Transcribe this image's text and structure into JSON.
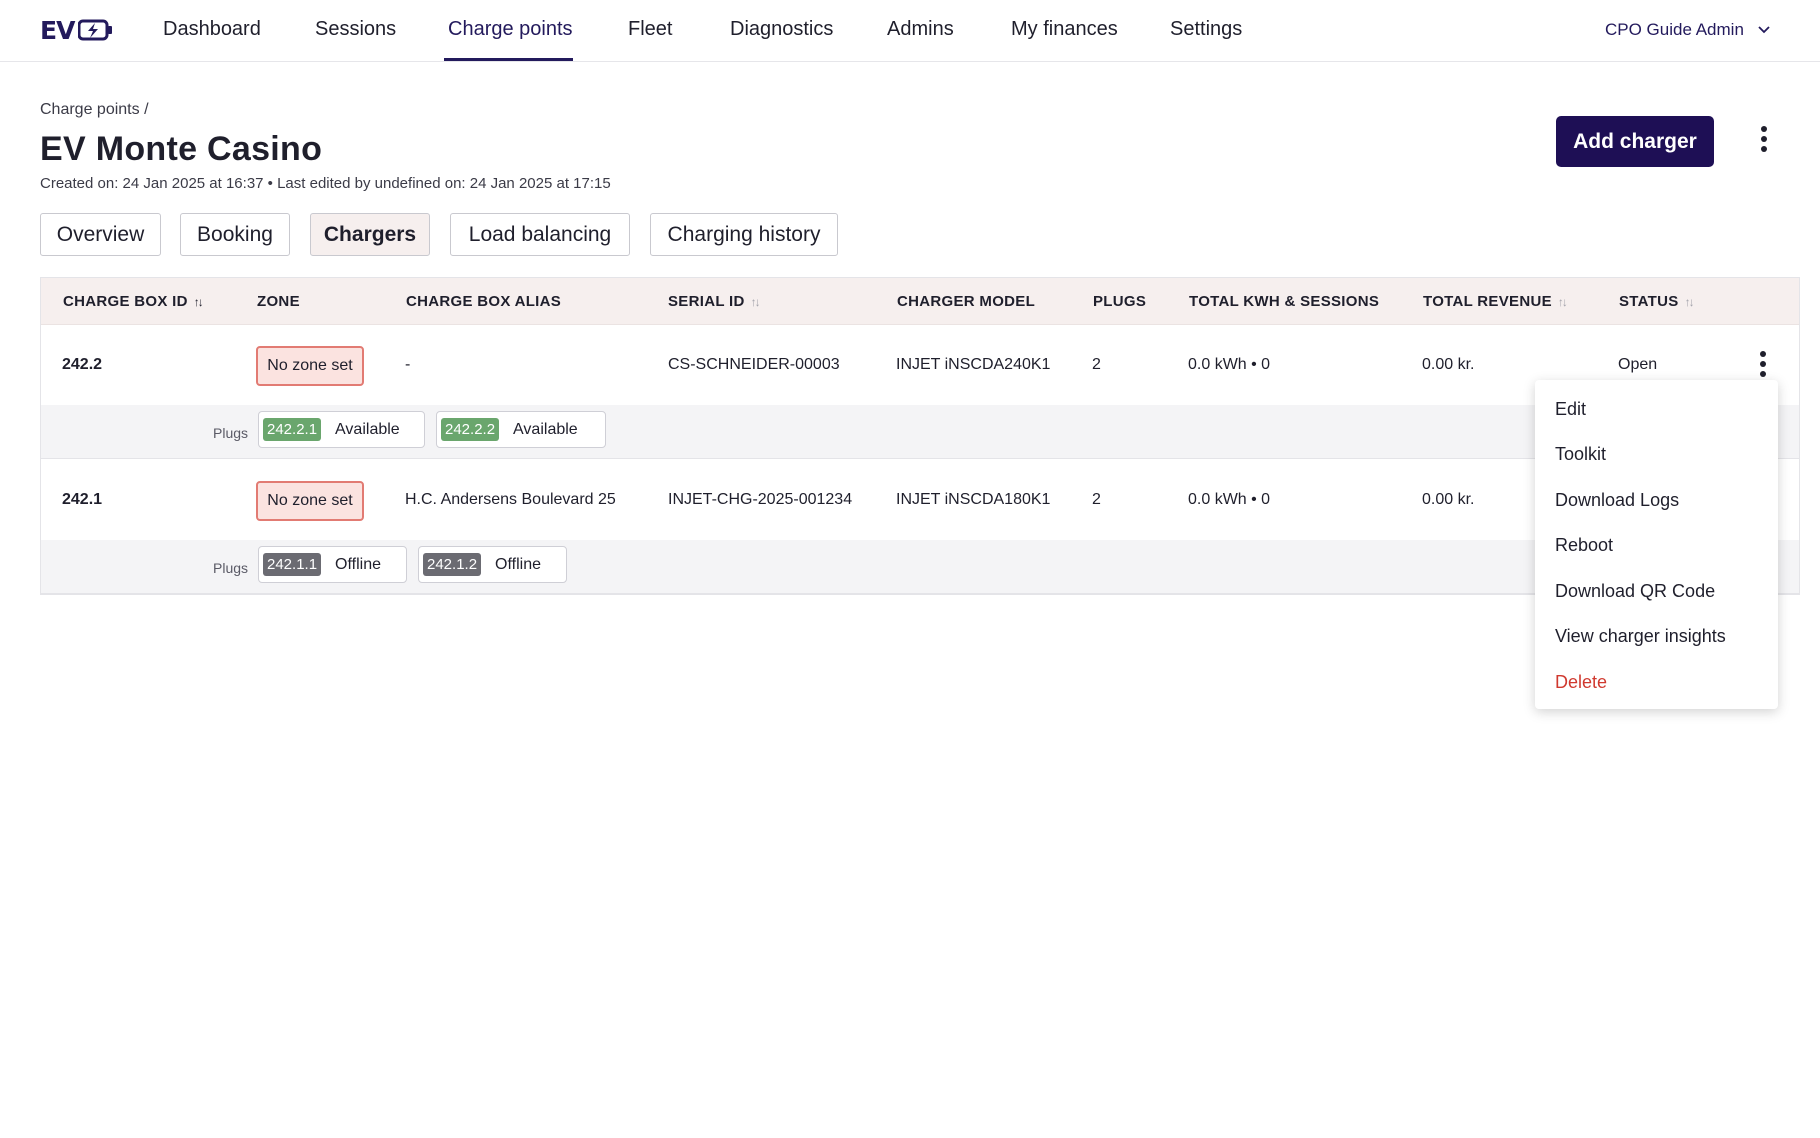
{
  "nav": {
    "logo": "EV",
    "items": [
      "Dashboard",
      "Sessions",
      "Charge points",
      "Fleet",
      "Diagnostics",
      "Admins",
      "My finances",
      "Settings"
    ],
    "active": "Charge points",
    "user": "CPO Guide Admin"
  },
  "header": {
    "breadcrumb": "Charge points /",
    "title": "EV Monte Casino",
    "meta": "Created on: 24 Jan 2025 at 16:37 • Last edited by undefined on: 24 Jan 2025 at 17:15",
    "add_button": "Add charger"
  },
  "tabs": [
    "Overview",
    "Booking",
    "Chargers",
    "Load balancing",
    "Charging history"
  ],
  "active_tab": "Chargers",
  "table": {
    "columns": [
      "CHARGE BOX ID",
      "ZONE",
      "CHARGE BOX ALIAS",
      "SERIAL ID",
      "CHARGER MODEL",
      "PLUGS",
      "TOTAL KWH & SESSIONS",
      "TOTAL REVENUE",
      "STATUS"
    ],
    "plugs_label": "Plugs",
    "rows": [
      {
        "id": "242.2",
        "zone": "No zone set",
        "alias": "-",
        "serial": "CS-SCHNEIDER-00003",
        "model": "INJET iNSCDA240K1",
        "plugs": "2",
        "kwh": "0.0 kWh • 0",
        "revenue": "0.00 kr.",
        "status": "Open",
        "plug_list": [
          {
            "id": "242.2.1",
            "state": "Available"
          },
          {
            "id": "242.2.2",
            "state": "Available"
          }
        ]
      },
      {
        "id": "242.1",
        "zone": "No zone set",
        "alias": "H.C. Andersens Boulevard 25",
        "serial": "INJET-CHG-2025-001234",
        "model": "INJET iNSCDA180K1",
        "plugs": "2",
        "kwh": "0.0 kWh • 0",
        "revenue": "0.00 kr.",
        "status": "",
        "plug_list": [
          {
            "id": "242.1.1",
            "state": "Offline"
          },
          {
            "id": "242.1.2",
            "state": "Offline"
          }
        ]
      }
    ]
  },
  "menu": [
    "Edit",
    "Toolkit",
    "Download Logs",
    "Reboot",
    "Download QR Code",
    "View charger insights",
    "Delete"
  ],
  "colors": {
    "brand": "#1e0f55",
    "available": "#6aa66d",
    "offline": "#6b6b72",
    "zone_border": "#e27b73",
    "danger": "#d0392f",
    "header_bg": "#f6efee"
  },
  "icons": {
    "logo": "ev-bolt-logo-icon",
    "user_menu": "chevron-down-icon",
    "kebab": "kebab-menu-icon",
    "sort": "sort-arrows-icon"
  }
}
